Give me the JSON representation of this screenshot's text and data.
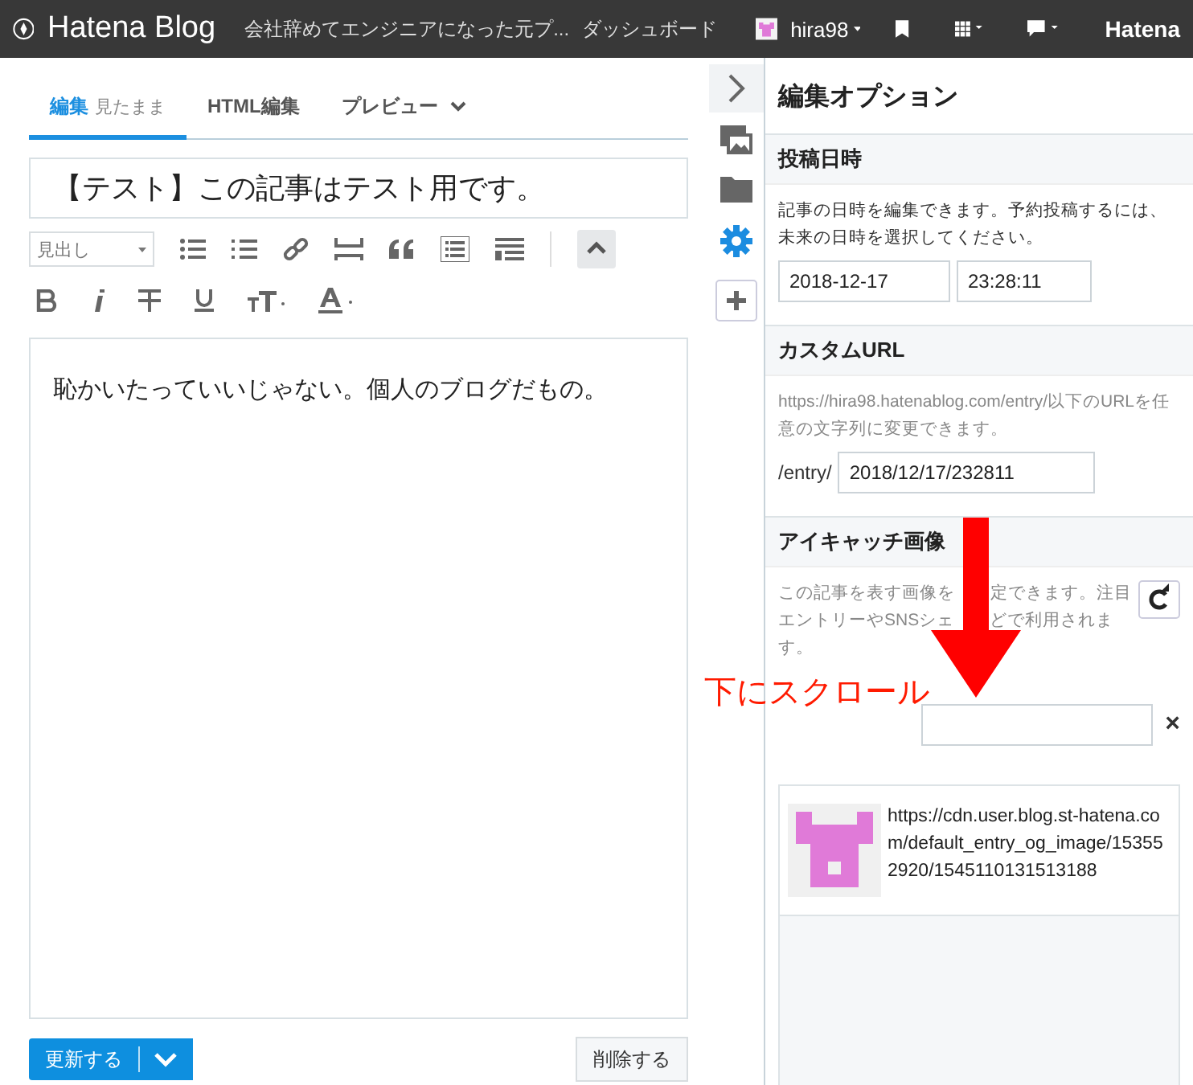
{
  "header": {
    "logo": "Hatena Blog",
    "blog_title": "会社辞めてエンジニアになった元プ...",
    "dashboard": "ダッシュボード",
    "user": "hira98",
    "brand": "Hatena"
  },
  "tabs": [
    {
      "label": "編集",
      "sub": "見たまま",
      "selected": true
    },
    {
      "label": "HTML編集",
      "selected": false
    },
    {
      "label": "プレビュー",
      "menu": true,
      "selected": false
    }
  ],
  "title": "【テスト】この記事はテスト用です。",
  "heading_select": "見出し",
  "body": "恥かいたっていいじゃない。個人のブログだもの。",
  "update_button": "更新する",
  "delete_button": "削除する",
  "options": {
    "title": "編集オプション",
    "date": {
      "heading": "投稿日時",
      "note": "記事の日時を編集できます。予約投稿するには、未来の日時を選択してください。",
      "date": "2018-12-17",
      "time": "23:28:11"
    },
    "url": {
      "heading": "カスタムURL",
      "note": "https://hira98.hatenablog.com/entry/以下のURLを任意の文字列に変更できます。",
      "prefix": "/entry/",
      "value": "2018/12/17/232811"
    },
    "eyecatch": {
      "heading": "アイキャッチ画像",
      "note_lines": [
        [
          "この記事を表す画像を",
          "定できます。注目"
        ],
        [
          "エントリーやSNSシェ",
          "どで利用されま"
        ],
        [
          "す。"
        ]
      ],
      "image_url": "https://cdn.user.blog.st-hatena.com/default_entry_og_image/153552920/1545110131513188",
      "clear": "×"
    }
  },
  "annotation": "下にスクロール"
}
